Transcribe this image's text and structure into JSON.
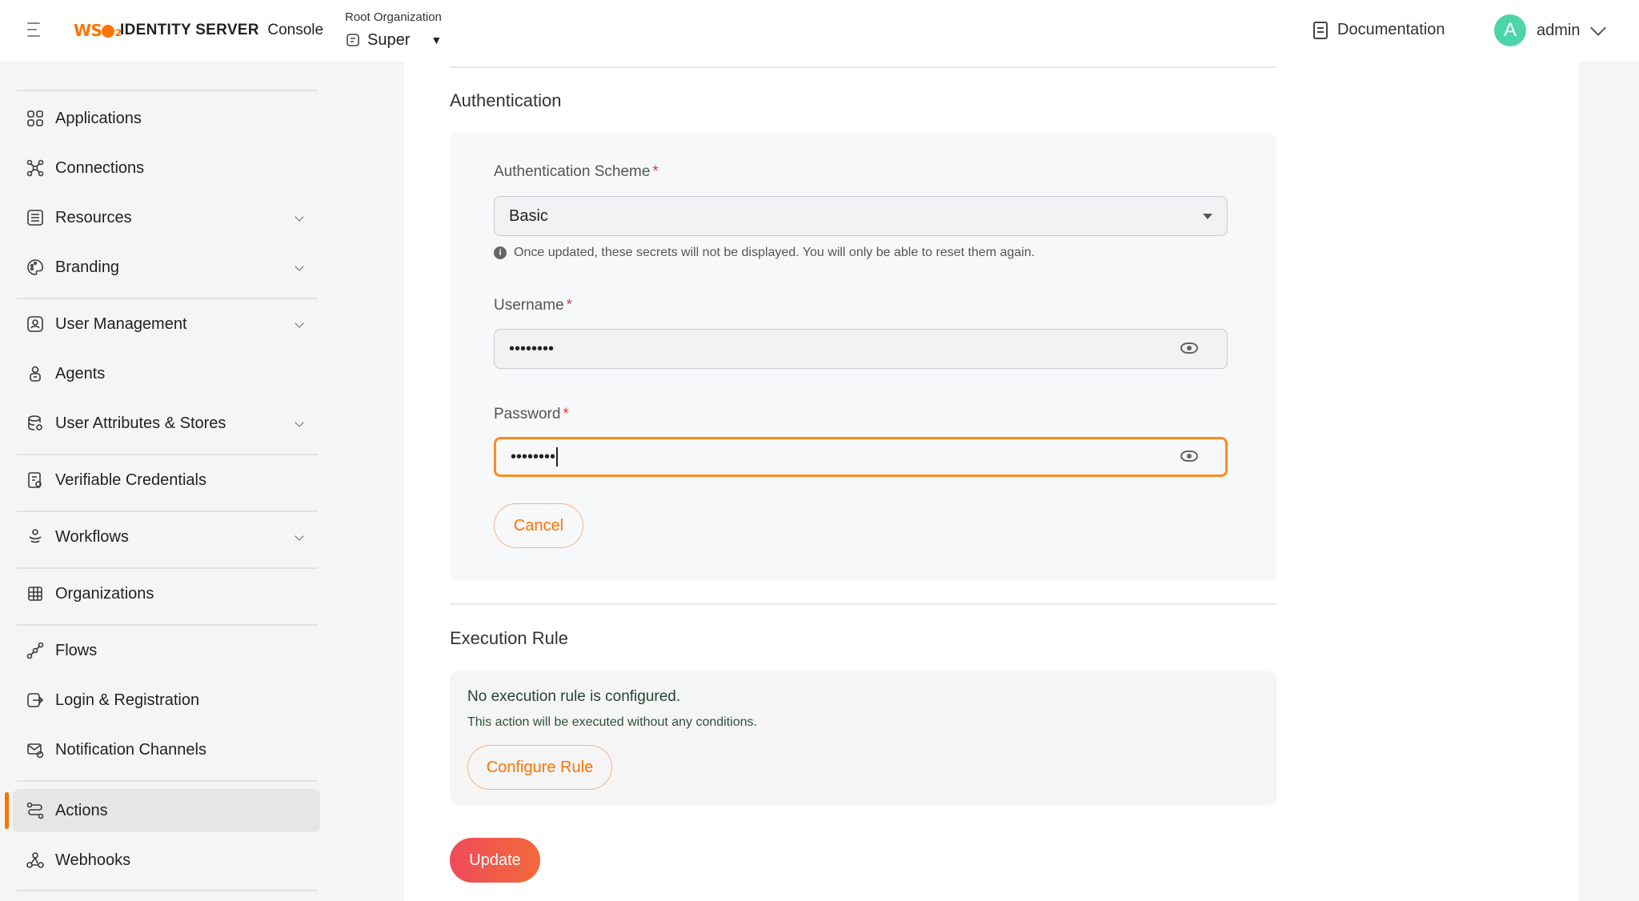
{
  "header": {
    "logo_text": "WSO2",
    "product_name": "IDENTITY SERVER",
    "product_suffix": "Console",
    "org_label": "Root Organization",
    "org_value": "Super",
    "documentation": "Documentation",
    "avatar_letter": "A",
    "user": "admin"
  },
  "sidebar": {
    "items": [
      {
        "label": "Applications",
        "icon": "grid-icon"
      },
      {
        "label": "Connections",
        "icon": "connections-icon"
      },
      {
        "label": "Resources",
        "icon": "list-icon"
      },
      {
        "label": "Branding",
        "icon": "palette-icon"
      },
      {
        "label": "User Management",
        "icon": "user-card-icon"
      },
      {
        "label": "Agents",
        "icon": "agent-icon"
      },
      {
        "label": "User Attributes & Stores",
        "icon": "database-icon"
      },
      {
        "label": "Verifiable Credentials",
        "icon": "credential-icon"
      },
      {
        "label": "Workflows",
        "icon": "workflow-icon"
      },
      {
        "label": "Organizations",
        "icon": "building-icon"
      },
      {
        "label": "Flows",
        "icon": "flows-icon"
      },
      {
        "label": "Login & Registration",
        "icon": "login-icon"
      },
      {
        "label": "Notification Channels",
        "icon": "mail-icon"
      },
      {
        "label": "Actions",
        "icon": "actions-icon"
      },
      {
        "label": "Webhooks",
        "icon": "webhook-icon"
      }
    ],
    "active": "Actions"
  },
  "auth": {
    "title": "Authentication",
    "scheme_label": "Authentication Scheme",
    "scheme_value": "Basic",
    "hint": "Once updated, these secrets will not be displayed. You will only be able to reset them again.",
    "username_label": "Username",
    "username_value": "••••••••",
    "password_label": "Password",
    "password_value": "••••••••",
    "cancel": "Cancel"
  },
  "execution": {
    "title": "Execution Rule",
    "message": "No execution rule is configured.",
    "sub": "This action will be executed without any conditions.",
    "configure": "Configure Rule"
  },
  "update": "Update",
  "colors": {
    "accent": "#ff7300",
    "avatar": "#4dd4a9",
    "required": "#e53935"
  }
}
